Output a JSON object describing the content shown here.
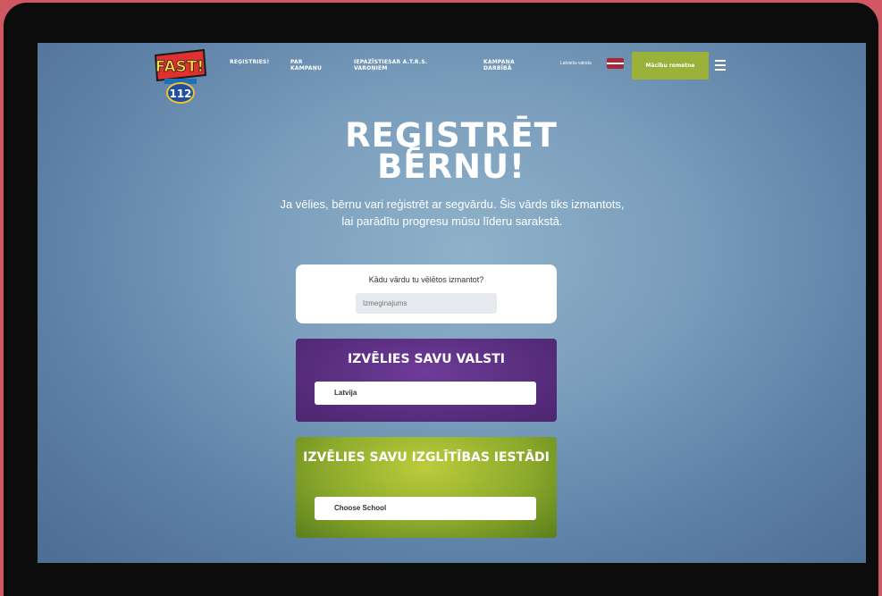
{
  "nav": {
    "links": [
      "Reģistries!",
      "Par kampaņu",
      "Iepazīstiesar A.T.R.S. varoņiem",
      "Kampaņa darbībā"
    ],
    "language": "Latviešu valoda",
    "cta": "Mācību rometne",
    "logo_text": "FAST!",
    "logo_number": "112"
  },
  "page": {
    "title_line1": "REĢISTRĒT",
    "title_line2": "BĒRNU!",
    "intro": "Ja vēlies, bērnu vari reģistrēt ar segvārdu. Šis vārds tiks izmantots, lai parādītu progresu mūsu līderu sarakstā."
  },
  "name_card": {
    "question": "Kādu vārdu tu vēlētos izmantot?",
    "placeholder": "Izmeginajums"
  },
  "country_card": {
    "heading": "IZVĒLIES SAVU VALSTI",
    "selected": "Latvija"
  },
  "school_card": {
    "heading": "IZVĒLIES SAVU IZGLĪTĪBAS IESTĀDI",
    "selected": "Choose School"
  },
  "colors": {
    "background": "#cf5863",
    "accent_green": "#9bb23a",
    "purple": "#552b7a"
  }
}
